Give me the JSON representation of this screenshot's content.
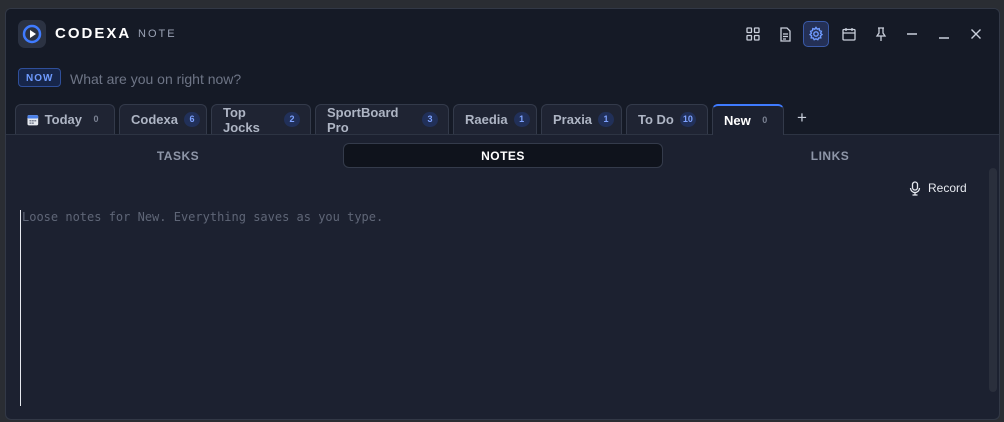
{
  "app": {
    "brand": "CODEXA",
    "sub": "NOTE"
  },
  "toolbar": {
    "icons": [
      "grid-icon",
      "document-icon",
      "gear-icon",
      "calendar-icon",
      "pin-icon",
      "minus-icon",
      "minimize-icon",
      "close-icon"
    ]
  },
  "now": {
    "badge": "NOW",
    "placeholder": "What are you on right now?"
  },
  "tabs": [
    {
      "label": "Today",
      "count": "0"
    },
    {
      "label": "Codexa",
      "count": "6"
    },
    {
      "label": "Top Jocks",
      "count": "2"
    },
    {
      "label": "SportBoard Pro",
      "count": "3"
    },
    {
      "label": "Raedia",
      "count": "1"
    },
    {
      "label": "Praxia",
      "count": "1"
    },
    {
      "label": "To Do",
      "count": "10"
    },
    {
      "label": "New",
      "count": "0"
    }
  ],
  "active_tab": "New",
  "add_tab": "+",
  "subtabs": {
    "tasks": "TASKS",
    "notes": "NOTES",
    "links": "LINKS"
  },
  "active_subtab": "NOTES",
  "record": {
    "label": "Record"
  },
  "notes": {
    "placeholder": "Loose notes for New. Everything saves as you type.",
    "value": ""
  },
  "colors": {
    "accent": "#3f7bff",
    "background": "#1c2130",
    "badge": "#6f9bff"
  }
}
